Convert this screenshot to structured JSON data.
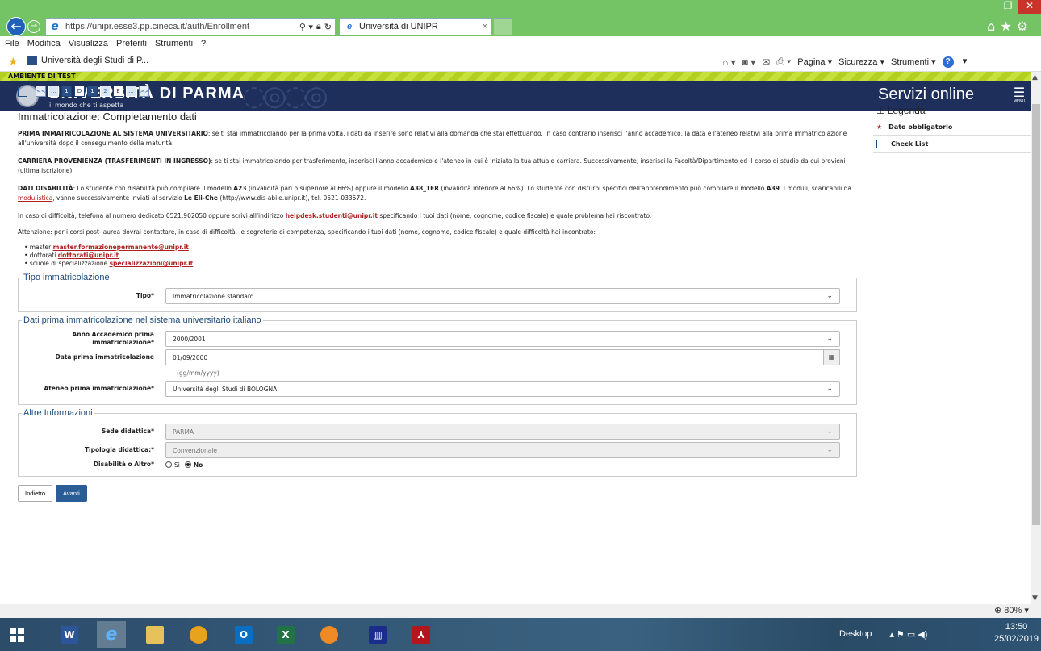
{
  "window": {
    "minimize": "—",
    "maximize": "❐",
    "close": "✕"
  },
  "browser": {
    "url": "https://unipr.esse3.pp.cineca.it/auth/Enrollment",
    "tab_title": "Università di UNIPR",
    "menu": [
      "File",
      "Modifica",
      "Visualizza",
      "Preferiti",
      "Strumenti",
      "?"
    ],
    "favorite": "Università degli Studi di P...",
    "commands": {
      "pagina": "Pagina ▾",
      "sicurezza": "Sicurezza ▾",
      "strumenti": "Strumenti ▾"
    },
    "zoom": "80%"
  },
  "site": {
    "test_banner": "AMBIENTE DI TEST",
    "name": "UNIVERSITÀ DI PARMA",
    "tagline": "il mondo che ti aspetta",
    "services": "Servizi online",
    "menu_label": "MENU"
  },
  "steps": [
    "<<",
    "...",
    "1",
    "D",
    "1",
    "2",
    "E",
    "...",
    ">>"
  ],
  "page": {
    "title": "Immatricolazione: Completamento dati",
    "p1_bold": "PRIMA IMMATRICOLAZIONE AL SISTEMA UNIVERSITARIO",
    "p1_text": ": se ti stai immatricolando per la prima volta, i dati da inserire sono relativi alla domanda che stai effettuando. In caso contrario inserisci l'anno accademico, la data e l'ateneo relativi alla prima immatricolazione all'università dopo il conseguimento della maturità.",
    "p2_bold": "CARRIERA PROVENIENZA (TRASFERIMENTI IN INGRESSO)",
    "p2_text": ": se ti stai immatricolando per trasferimento, inserisci l'anno accademico e l'ateneo in cui è iniziata la tua attuale carriera. Successivamente, inserisci la Facoltà/Dipartimento ed il corso di studio da cui provieni (ultima iscrizione).",
    "p3_bold": "DATI DISABILITÀ",
    "p3_a": ": Lo studente con disabilità può compilare il modello ",
    "p3_a23": "A23",
    "p3_b": " (invalidità pari o superiore al 66%) oppure il modello ",
    "p3_a38": "A38_TER",
    "p3_c": " (invalidità inferiore al 66%). Lo studente con disturbi specifici dell'apprendimento può compilare il modello ",
    "p3_a39": "A39",
    "p3_d": ". I moduli, scaricabili da ",
    "p3_link": "modulistica",
    "p3_e": ", vanno successivamente inviati al servizio ",
    "p3_service": "Le Eli-Che",
    "p3_f": " (http://www.dis-abile.unipr.it), tel. 0521-033572.",
    "p4_a": "In caso di difficoltà, telefona al numero dedicato 0521.902050 oppure scrivi all'indirizzo ",
    "p4_email": "helpdesk.studenti@unipr.it",
    "p4_b": " specificando i tuoi dati (nome, cognome, codice fiscale) e quale problema hai riscontrato.",
    "p5": "Attenzione: per i corsi post-laurea dovrai contattare, in caso di difficoltà, le segreterie di competenza, specificando i tuoi dati (nome, cognome, codice fiscale) e quale difficoltà hai incontrato:",
    "contacts": [
      {
        "label": "• master ",
        "email": "master.formazionepermanente@unipr.it"
      },
      {
        "label": "• dottorati ",
        "email": "dottorati@unipr.it"
      },
      {
        "label": "• scuole di specializzazione ",
        "email": "specializzazioni@unipr.it"
      }
    ]
  },
  "legend": {
    "title": "Legenda",
    "required": "Dato obbligatorio",
    "checklist": "Check List"
  },
  "form": {
    "tipo": {
      "legend": "Tipo immatricolazione",
      "label": "Tipo*",
      "value": "Immatricolazione standard"
    },
    "prima": {
      "legend": "Dati prima immatricolazione nel sistema universitario italiano",
      "anno_label": "Anno Accademico prima immatricolazione*",
      "anno_value": "2000/2001",
      "data_label": "Data prima immatricolazione",
      "data_value": "01/09/2000",
      "data_hint": "(gg/mm/yyyy)",
      "ateneo_label": "Ateneo prima immatricolazione*",
      "ateneo_value": "Università degli Studi di BOLOGNA"
    },
    "altre": {
      "legend": "Altre Informazioni",
      "sede_label": "Sede didattica*",
      "sede_value": "PARMA",
      "tipologia_label": "Tipologia didattica:*",
      "tipologia_value": "Convenzionale",
      "disab_label": "Disabilità o Altro*",
      "si": "Si",
      "no": "No",
      "selected": "No"
    },
    "back": "Indietro",
    "next": "Avanti"
  },
  "taskbar": {
    "desktop": "Desktop",
    "time": "13:50",
    "date": "25/02/2019"
  },
  "colors": {
    "ie_frame": "#74c466",
    "site_header": "#1d2f5a",
    "primary_button": "#2a5d96",
    "link_red": "#b02020"
  }
}
